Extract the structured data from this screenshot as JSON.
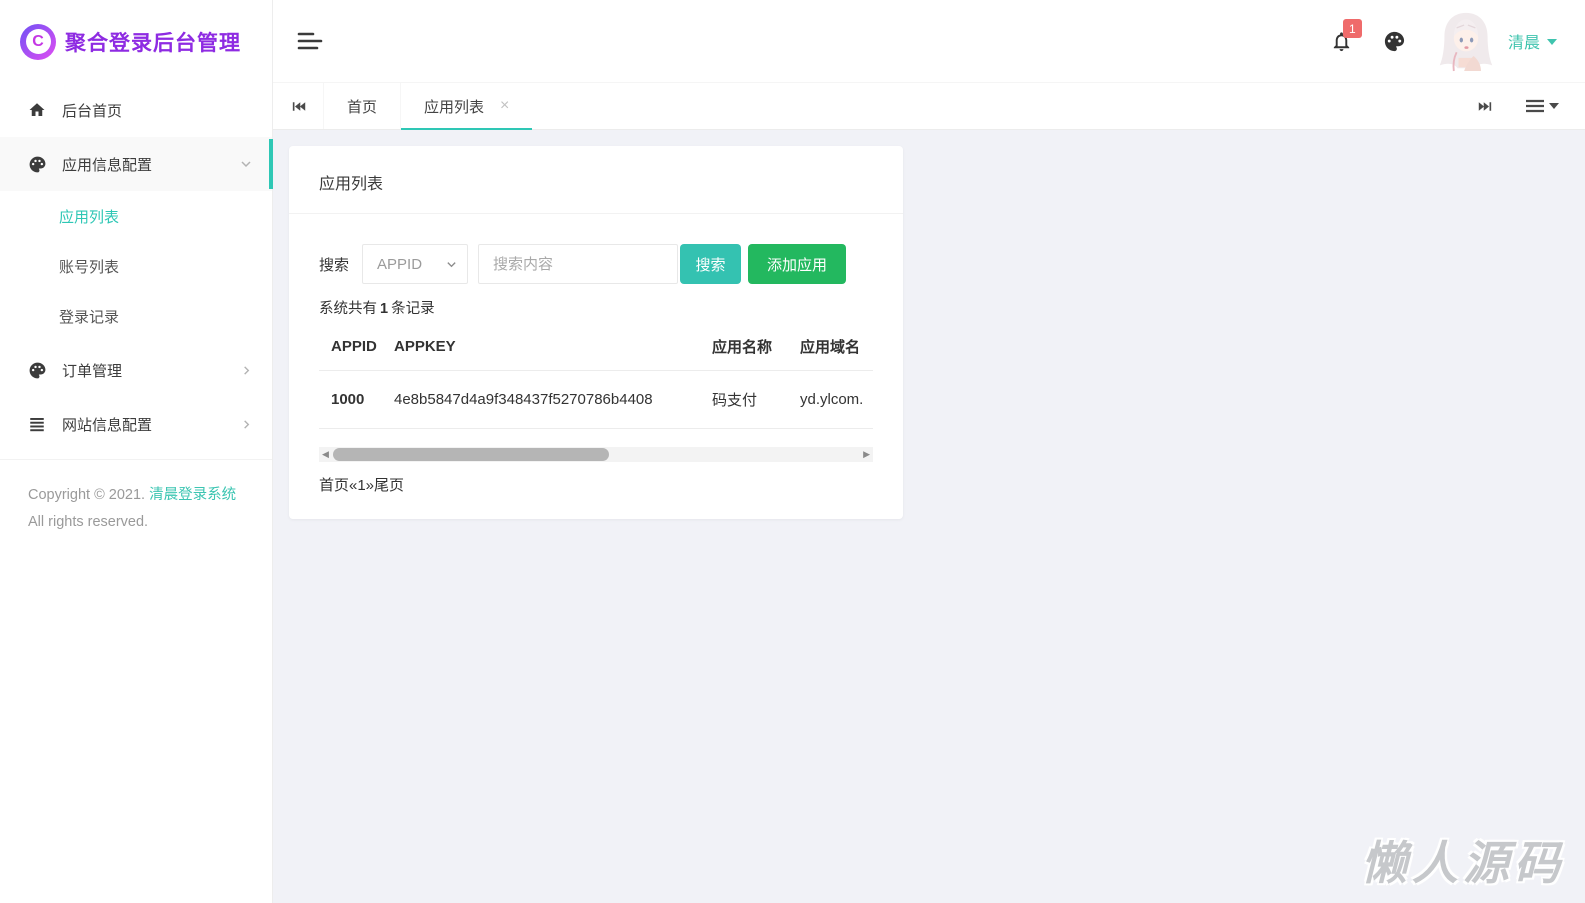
{
  "brand": {
    "name": "聚合登录后台管理",
    "logo_letter": "C"
  },
  "topbar": {
    "badge_count": "1",
    "username": "清晨"
  },
  "sidebar": {
    "items": [
      {
        "label": "后台首页",
        "icon": "home-icon"
      },
      {
        "label": "应用信息配置",
        "icon": "palette-icon"
      },
      {
        "label": "订单管理",
        "icon": "palette-icon"
      },
      {
        "label": "网站信息配置",
        "icon": "list-icon"
      }
    ],
    "submenu": [
      "应用列表",
      "账号列表",
      "登录记录"
    ],
    "active_submenu": "应用列表",
    "copyright_prefix": "Copyright © 2021.",
    "copyright_link": "清晨登录系统",
    "copyright_suffix": "All rights reserved."
  },
  "tabs": {
    "home": "首页",
    "current": "应用列表",
    "close_glyph": "×"
  },
  "panel": {
    "title": "应用列表",
    "search_label": "搜索",
    "search_field_selected": "APPID",
    "search_placeholder": "搜索内容",
    "search_button": "搜索",
    "add_button": "添加应用",
    "summary_prefix": "系统共有",
    "summary_count": "1",
    "summary_suffix": "条记录",
    "table": {
      "headers": [
        "APPID",
        "APPKEY",
        "应用名称",
        "应用域名"
      ],
      "rows": [
        [
          "1000",
          "4e8b5847d4a9f348437f5270786b4408",
          "码支付",
          "yd.ylcom."
        ]
      ]
    },
    "scrollbar": {
      "left_arrow": "◀",
      "right_arrow": "▶"
    },
    "pagination": "首页«1»尾页"
  },
  "watermark": "懒人源码",
  "colors": {
    "accent_teal": "#2ec7b5",
    "button_teal": "#34c2b1",
    "button_green": "#23b85f",
    "brand_purple": "#8e2be2",
    "badge_red": "#ef6b6b"
  }
}
